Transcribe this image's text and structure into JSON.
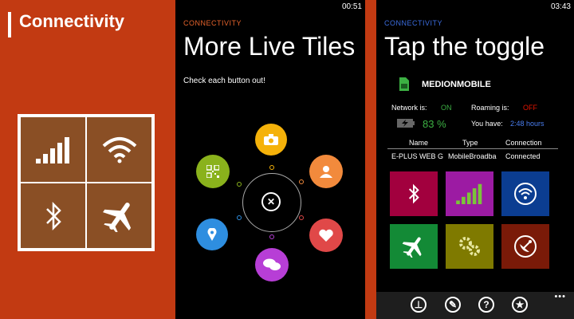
{
  "left": {
    "title": "Connectivity"
  },
  "phone1": {
    "clock": "00:51",
    "app_title": "CONNECTIVITY",
    "page_title": "More Live Tiles",
    "subtitle": "Check each button out!"
  },
  "phone2": {
    "clock": "03:43",
    "app_title": "CONNECTIVITY",
    "page_title": "Tap the toggle",
    "operator": "MEDIONMOBILE",
    "network_label": "Network is:",
    "network_value": "ON",
    "roaming_label": "Roaming is:",
    "roaming_value": "OFF",
    "battery": "83 %",
    "have_label": "You have:",
    "have_value": "2:48 hours",
    "table": {
      "headers": [
        "Name",
        "Type",
        "Connection"
      ],
      "row": [
        "E-PLUS WEB G",
        "MobileBroadba",
        "Connected"
      ]
    },
    "more": "•••"
  },
  "colors": {
    "accent_orange": "#c23a12",
    "app_title_orange": "#e8642c",
    "app_title_blue": "#3b6de0",
    "on_green": "#3cb043",
    "off_red": "#e51400",
    "link_blue": "#4a7ef0"
  }
}
